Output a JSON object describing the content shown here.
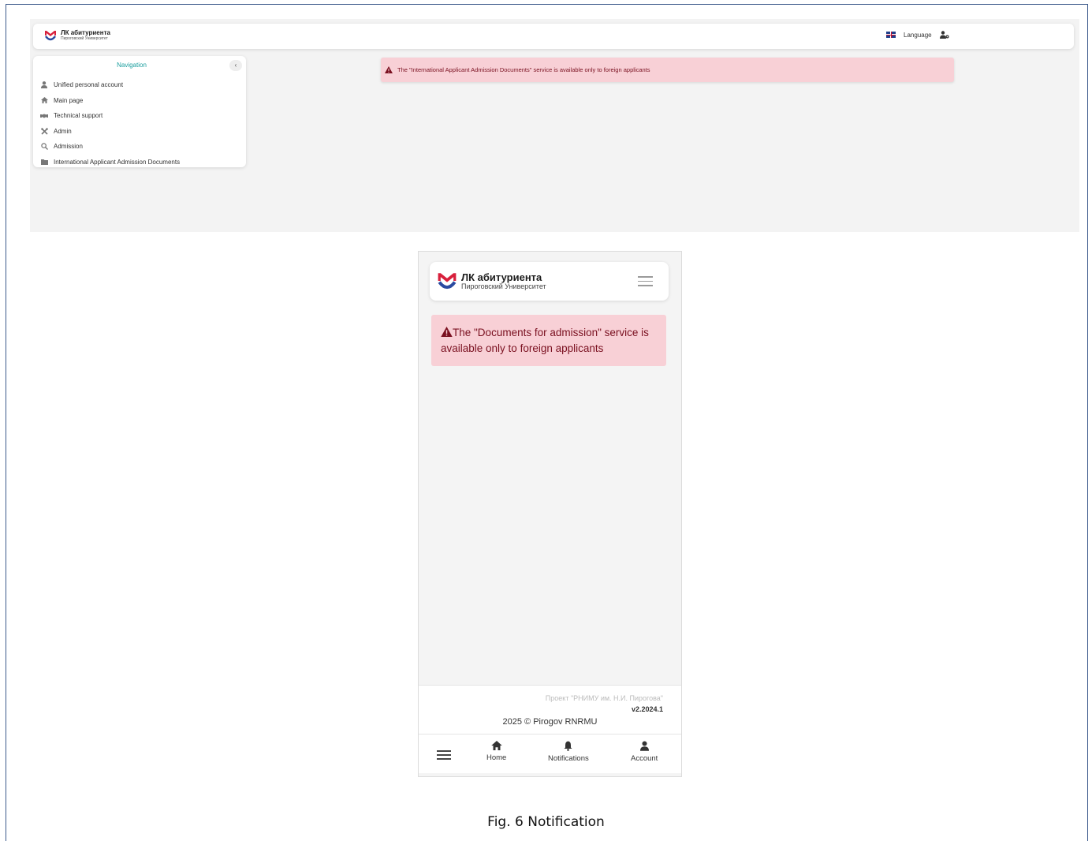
{
  "desktop": {
    "logo": {
      "title": "ЛК абитуриента",
      "subtitle": "Пироговский Университет"
    },
    "header": {
      "language_label": "Language"
    },
    "nav": {
      "title": "Navigation",
      "collapse_glyph": "‹",
      "items": [
        {
          "label": "Unified personal account",
          "icon": "user-icon"
        },
        {
          "label": "Main page",
          "icon": "home-icon"
        },
        {
          "label": "Technical support",
          "icon": "handshake-icon"
        },
        {
          "label": "Admin",
          "icon": "tools-icon"
        },
        {
          "label": "Admission",
          "icon": "search-icon"
        },
        {
          "label": "International Applicant Admission Documents",
          "icon": "folder-icon"
        }
      ]
    },
    "alert": {
      "text": "The \"International Applicant Admission Documents\" service is available only to foreign applicants"
    }
  },
  "mobile": {
    "logo": {
      "title": "ЛК абитуриента",
      "subtitle": "Пироговский Университет"
    },
    "alert": {
      "text": "The \"Documents for admission\" service is available only to foreign applicants"
    },
    "footer": {
      "project": "Проект \"РНИМУ им. Н.И. Пирогова\"",
      "version": "v2.2024.1",
      "copyright": "2025 © Pirogov RNRMU"
    },
    "bottom_nav": {
      "home": "Home",
      "notifications": "Notifications",
      "account": "Account"
    }
  },
  "caption": "Fig. 6 Notification",
  "colors": {
    "brand_red": "#d8203c",
    "brand_blue": "#2a4aa0",
    "alert_bg": "#f8d0d6",
    "alert_text": "#7a1020",
    "nav_title": "#1a9e9e"
  }
}
